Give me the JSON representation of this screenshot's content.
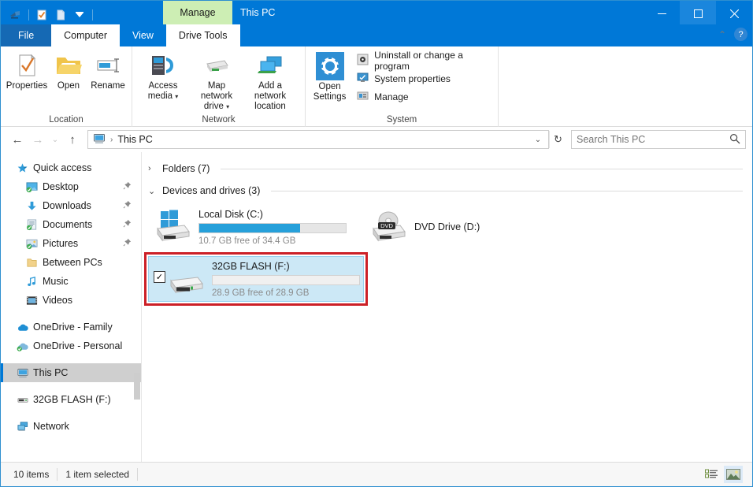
{
  "window": {
    "title": "This PC",
    "contextual_tab_header": "Manage",
    "quick_access_toolbar": [
      {
        "name": "explorer-icon",
        "label": "Explorer"
      },
      {
        "name": "properties-icon",
        "label": "Properties"
      },
      {
        "name": "new-folder-icon",
        "label": "New folder"
      },
      {
        "name": "customize-qat-chevron-icon",
        "label": "Customize Quick Access Toolbar"
      }
    ],
    "controls": {
      "minimize": "─",
      "maximize": "□",
      "close": "✕"
    }
  },
  "tabs": [
    {
      "label": "File",
      "state": "file"
    },
    {
      "label": "Computer",
      "state": "active"
    },
    {
      "label": "View",
      "state": "normal"
    },
    {
      "label": "Drive Tools",
      "state": "contextual-active"
    }
  ],
  "ribbon_right": {
    "collapse_label": "⌃",
    "help_label": "?"
  },
  "ribbon": {
    "groups": [
      {
        "label": "Location",
        "buttons": [
          {
            "label": "Properties",
            "icon": "properties-icon",
            "has_caret": false
          },
          {
            "label": "Open",
            "icon": "open-folder-icon",
            "has_caret": false
          },
          {
            "label": "Rename",
            "icon": "rename-icon",
            "has_caret": false
          }
        ]
      },
      {
        "label": "Network",
        "buttons": [
          {
            "label": "Access media",
            "icon": "access-media-icon",
            "has_caret": true
          },
          {
            "label": "Map network drive",
            "icon": "map-network-drive-icon",
            "has_caret": true
          },
          {
            "label": "Add a network location",
            "icon": "add-network-location-icon",
            "has_caret": false
          }
        ]
      },
      {
        "label": "System",
        "big_button": {
          "label": "Open Settings",
          "icon": "gear-icon"
        },
        "small_items": [
          {
            "label": "Uninstall or change a program",
            "icon": "uninstall-program-icon"
          },
          {
            "label": "System properties",
            "icon": "system-properties-icon"
          },
          {
            "label": "Manage",
            "icon": "manage-icon"
          }
        ]
      }
    ]
  },
  "addressbar": {
    "back": "←",
    "forward": "→",
    "recent": "⌄",
    "up": "↑",
    "breadcrumb_icon": "this-pc-icon",
    "breadcrumb": "This PC",
    "breadcrumb_sep": "›",
    "dropdown": "⌄",
    "refresh": "↻"
  },
  "search": {
    "placeholder": "Search This PC",
    "value": "",
    "icon": "search-icon"
  },
  "sidebar": {
    "items": [
      {
        "label": "Quick access",
        "icon": "quick-access-star-icon",
        "indent": "root",
        "pinned": false,
        "selected": false
      },
      {
        "label": "Desktop",
        "icon": "desktop-icon",
        "indent": "child",
        "pinned": true,
        "selected": false
      },
      {
        "label": "Downloads",
        "icon": "downloads-icon",
        "indent": "child",
        "pinned": true,
        "selected": false
      },
      {
        "label": "Documents",
        "icon": "documents-icon",
        "indent": "child",
        "pinned": true,
        "selected": false
      },
      {
        "label": "Pictures",
        "icon": "pictures-icon",
        "indent": "child",
        "pinned": true,
        "selected": false
      },
      {
        "label": "Between PCs",
        "icon": "folder-icon",
        "indent": "child",
        "pinned": false,
        "selected": false
      },
      {
        "label": "Music",
        "icon": "music-icon",
        "indent": "child",
        "pinned": false,
        "selected": false
      },
      {
        "label": "Videos",
        "icon": "videos-icon",
        "indent": "child",
        "pinned": false,
        "selected": false
      },
      {
        "label": "OneDrive - Family",
        "icon": "onedrive-icon",
        "indent": "root",
        "pinned": false,
        "selected": false,
        "gap_before": true
      },
      {
        "label": "OneDrive - Personal",
        "icon": "onedrive-synced-icon",
        "indent": "root",
        "pinned": false,
        "selected": false,
        "gap_before": true
      },
      {
        "label": "This PC",
        "icon": "this-pc-icon",
        "indent": "root",
        "pinned": false,
        "selected": true,
        "gap_before": true
      },
      {
        "label": "32GB FLASH (F:)",
        "icon": "usb-drive-icon",
        "indent": "root",
        "pinned": false,
        "selected": false,
        "gap_before": true
      },
      {
        "label": "Network",
        "icon": "network-icon",
        "indent": "root",
        "pinned": false,
        "selected": false,
        "gap_before": true
      }
    ]
  },
  "content": {
    "groups": [
      {
        "label": "Folders (7)",
        "expanded": false,
        "chevron": "›"
      },
      {
        "label": "Devices and drives (3)",
        "expanded": true,
        "chevron": "⌄"
      }
    ],
    "drives": [
      {
        "name": "Local Disk (C:)",
        "icon": "windows-local-disk-icon",
        "capacity_text": "10.7 GB free of 34.4 GB",
        "used_percent": 69,
        "free_gb": 10.7,
        "total_gb": 34.4,
        "has_bar": true,
        "selected": false,
        "highlighted": false,
        "checked": false
      },
      {
        "name": "DVD Drive (D:)",
        "icon": "dvd-drive-icon",
        "capacity_text": "",
        "used_percent": 0,
        "has_bar": false,
        "selected": false,
        "highlighted": false,
        "checked": false
      },
      {
        "name": "32GB FLASH (F:)",
        "icon": "usb-flash-drive-icon",
        "capacity_text": "28.9 GB free of 28.9 GB",
        "used_percent": 0,
        "free_gb": 28.9,
        "total_gb": 28.9,
        "has_bar": true,
        "selected": true,
        "highlighted": true,
        "checked": true,
        "check_glyph": "✓"
      }
    ]
  },
  "statusbar": {
    "item_count": "10 items",
    "selection": "1 item selected",
    "views": [
      {
        "name": "details-view-button",
        "active": false
      },
      {
        "name": "large-icons-view-button",
        "active": true
      }
    ]
  },
  "colors": {
    "titlebar_blue": "#0078d7",
    "contextual_green": "#cdeeb4",
    "selection_blue": "#cce8f6",
    "highlight_red": "#cc2027",
    "progress_blue": "#26a0da",
    "accent": "#0078d7"
  }
}
